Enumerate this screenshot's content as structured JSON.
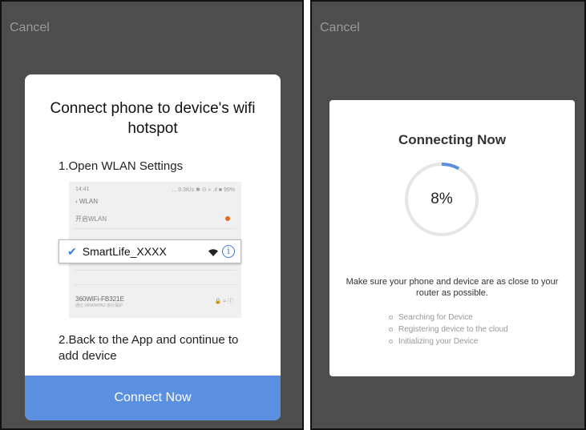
{
  "left_screen": {
    "cancel_label": "Cancel",
    "title": "Connect phone to device's wifi hotspot",
    "step1": "1.Open WLAN Settings",
    "wlan_screenshot": {
      "status_time": "14:41",
      "status_icons": "... 0.3K/s ✱ ⊙ ≈ .ıl ■ 99%",
      "back_label": "‹  WLAN",
      "open_wlan": "开启WLAN",
      "network_ssid": "360WiFi-FB321E",
      "network_sub": "通过 WPA/WPA2 进行保护",
      "network_icons": "🔒 ≈ ⓘ"
    },
    "highlight": {
      "check_icon": "check-icon",
      "ssid": "SmartLife_XXXX"
    },
    "step2": "2.Back to the App and continue to add device",
    "button_label": "Connect Now",
    "accent_color": "#5b8fdf"
  },
  "right_screen": {
    "cancel_label": "Cancel",
    "title": "Connecting Now",
    "progress_percent": 8,
    "progress_label": "8%",
    "message": "Make sure your phone and device are as close to your router as possible.",
    "steps": [
      "Searching for Device",
      "Registering device to the cloud",
      "Initializing your Device"
    ],
    "progress_color": "#5b8fdf",
    "track_color": "#e6e6e6"
  }
}
